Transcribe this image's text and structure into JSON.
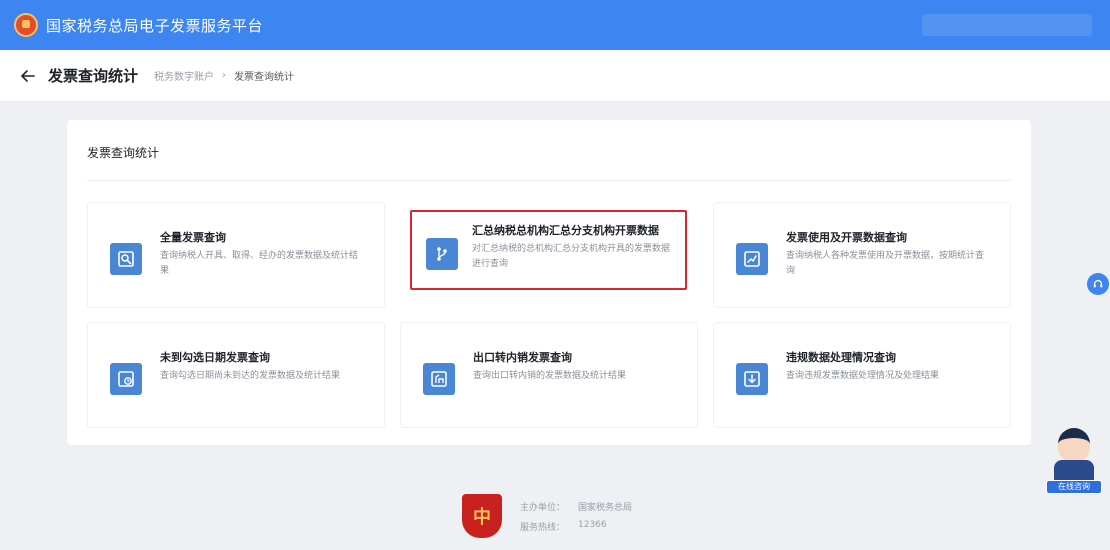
{
  "header": {
    "title": "国家税务总局电子发票服务平台",
    "emblem_icon": "national-emblem-icon"
  },
  "subheader": {
    "page_title": "发票查询统计",
    "breadcrumb": [
      "税务数字账户",
      "发票查询统计"
    ]
  },
  "panel": {
    "title": "发票查询统计",
    "cards": [
      {
        "title": "全量发票查询",
        "desc": "查询纳税人开具、取得、经办的发票数据及统计结果",
        "icon": "search-doc-icon",
        "highlight": false
      },
      {
        "title": "汇总纳税总机构汇总分支机构开票数据",
        "desc": "对汇总纳税的总机构汇总分支机构开具的发票数据进行查询",
        "icon": "branch-link-icon",
        "highlight": true
      },
      {
        "title": "发票使用及开票数据查询",
        "desc": "查询纳税人各种发票使用及开票数据，按期统计查询",
        "icon": "chart-doc-icon",
        "highlight": false
      },
      {
        "title": "未到勾选日期发票查询",
        "desc": "查询勾选日期尚未到达的发票数据及统计结果",
        "icon": "clock-doc-icon",
        "highlight": false
      },
      {
        "title": "出口转内销发票查询",
        "desc": "查询出口转内销的发票数据及统计结果",
        "icon": "export-doc-icon",
        "highlight": false
      },
      {
        "title": "违规数据处理情况查询",
        "desc": "查询违规发票数据处理情况及处理结果",
        "icon": "download-doc-icon",
        "highlight": false
      }
    ]
  },
  "assistant": {
    "label": "在线咨询",
    "icon": "assistant-mascot-icon"
  },
  "side_button_icon": "headset-icon",
  "footer": {
    "logo_char": "中",
    "line1": [
      "主办单位：",
      "国家税务总局"
    ],
    "line2": [
      "服务热线：",
      "12366"
    ]
  },
  "colors": {
    "primary": "#3d85f0",
    "card_icon": "#4a86d6",
    "highlight": "#d9262c"
  }
}
